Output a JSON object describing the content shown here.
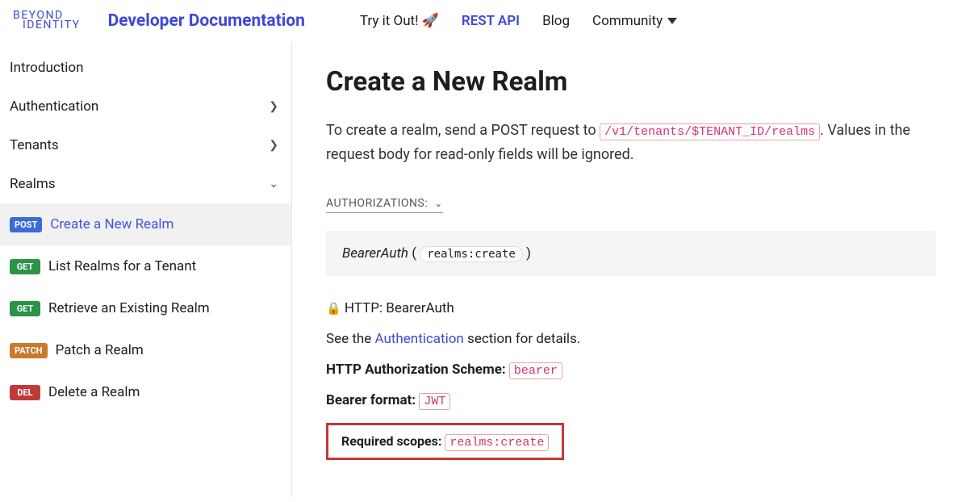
{
  "header": {
    "logo_line1": "BEYOND",
    "logo_line2": "IDENTITY",
    "doc_title": "Developer Documentation",
    "nav": {
      "try_it": "Try it Out! 🚀",
      "rest_api": "REST API",
      "blog": "Blog",
      "community": "Community"
    }
  },
  "sidebar": {
    "introduction": "Introduction",
    "authentication": "Authentication",
    "tenants": "Tenants",
    "realms": "Realms",
    "items": [
      {
        "method": "POST",
        "label": "Create a New Realm"
      },
      {
        "method": "GET",
        "label": "List Realms for a Tenant"
      },
      {
        "method": "GET",
        "label": "Retrieve an Existing Realm"
      },
      {
        "method": "PATCH",
        "label": "Patch a Realm"
      },
      {
        "method": "DEL",
        "label": "Delete a Realm"
      }
    ]
  },
  "main": {
    "title": "Create a New Realm",
    "desc_part1": "To create a realm, send a POST request to ",
    "desc_code": "/v1/tenants/$TENANT_ID/realms",
    "desc_part2": ". Values in the request body for read-only fields will be ignored.",
    "auth_section": "AUTHORIZATIONS:",
    "bearer_auth": "BearerAuth",
    "scope_pill": "realms:create",
    "http_bearer": "HTTP: BearerAuth",
    "see_text": "See the ",
    "auth_link": "Authentication",
    "see_text2": " section for details.",
    "http_scheme_label": "HTTP Authorization Scheme:",
    "http_scheme_value": "bearer",
    "bearer_format_label": "Bearer format:",
    "bearer_format_value": "JWT",
    "required_scopes_label": "Required scopes:",
    "required_scopes_value": "realms:create"
  }
}
